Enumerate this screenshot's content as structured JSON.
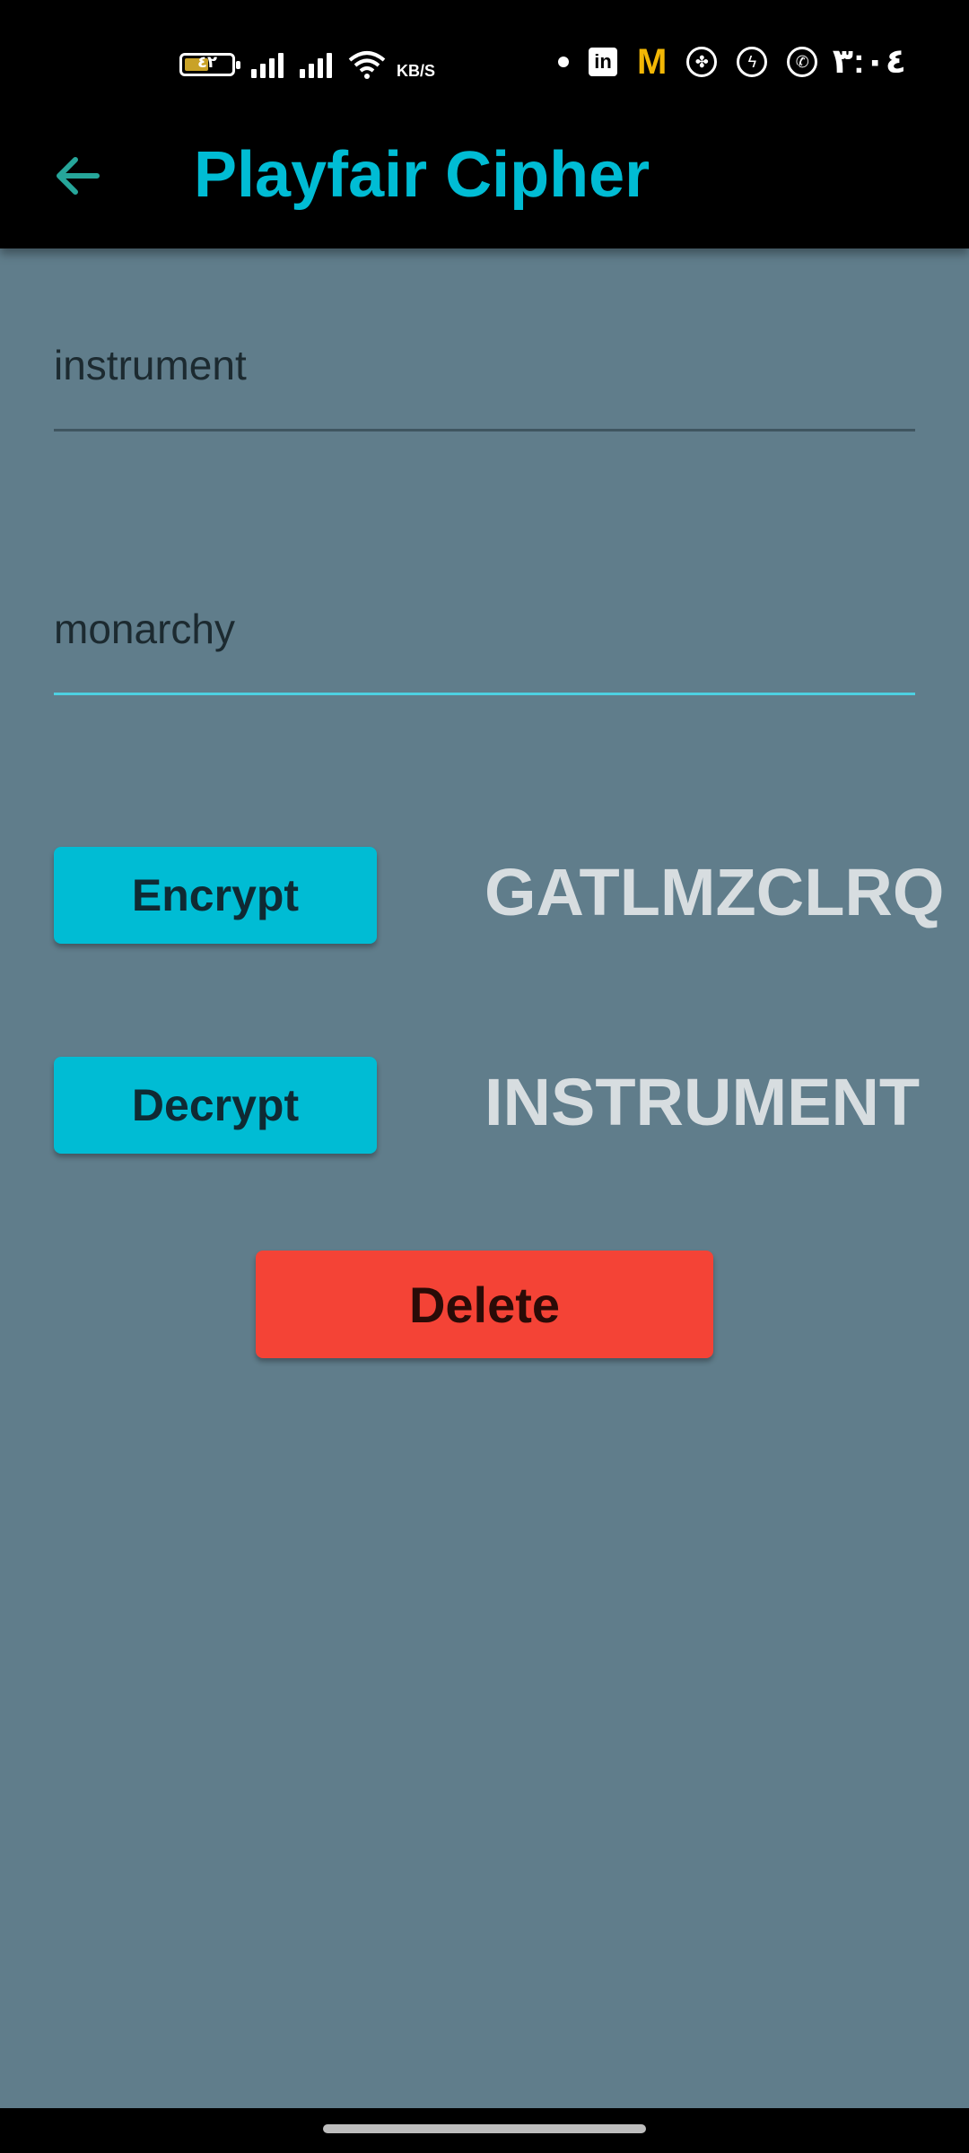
{
  "status_bar": {
    "battery_level": "٤٢",
    "network_speed": "KB/S",
    "time": "٣:٠٤",
    "notification_icons": [
      "linkedin-icon",
      "mcdonalds-icon",
      "clover-icon",
      "messenger-icon",
      "whatsapp-icon"
    ]
  },
  "app_bar": {
    "title": "Playfair Cipher",
    "back_icon": "arrow-back-icon"
  },
  "form": {
    "message_value": "instrument",
    "key_value": "monarchy"
  },
  "actions": {
    "encrypt_label": "Encrypt",
    "decrypt_label": "Decrypt",
    "delete_label": "Delete"
  },
  "results": {
    "encrypted_text": "GATLMZCLRQ",
    "decrypted_text": "INSTRUMENT"
  },
  "colors": {
    "background": "#607d8b",
    "accent": "#00bcd4",
    "delete": "#f44336",
    "active_underline": "#4dd0e1"
  }
}
